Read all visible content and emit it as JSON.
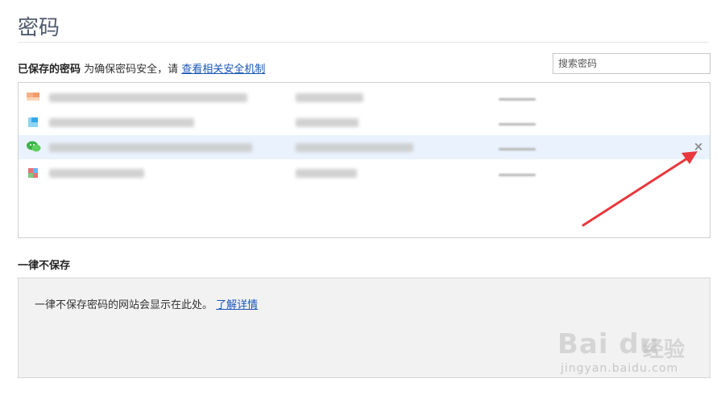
{
  "page": {
    "title": "密码"
  },
  "saved_passwords": {
    "heading": "已保存的密码",
    "description": "为确保密码安全，请",
    "security_link": "查看相关安全机制",
    "search_placeholder": "搜索密码",
    "rows": [
      {
        "favicon_color": "#f6a97a",
        "selected": false
      },
      {
        "favicon_color": "#4fc3f7",
        "selected": false
      },
      {
        "favicon_color": "#3bb34a",
        "favicon_icon": "wechat-icon",
        "selected": true,
        "remove_label": "×"
      },
      {
        "favicon_color": "#e57373",
        "selected": false
      }
    ]
  },
  "never_saved": {
    "heading": "一律不保存",
    "message": "一律不保存密码的网站会显示在此处。",
    "learn_more_link": "了解详情"
  },
  "annotation": {
    "arrow_color": "#e8383d"
  },
  "watermark": {
    "brand": "Bai du",
    "brand_cn": "经验",
    "url": "jingyan.baidu.com"
  }
}
